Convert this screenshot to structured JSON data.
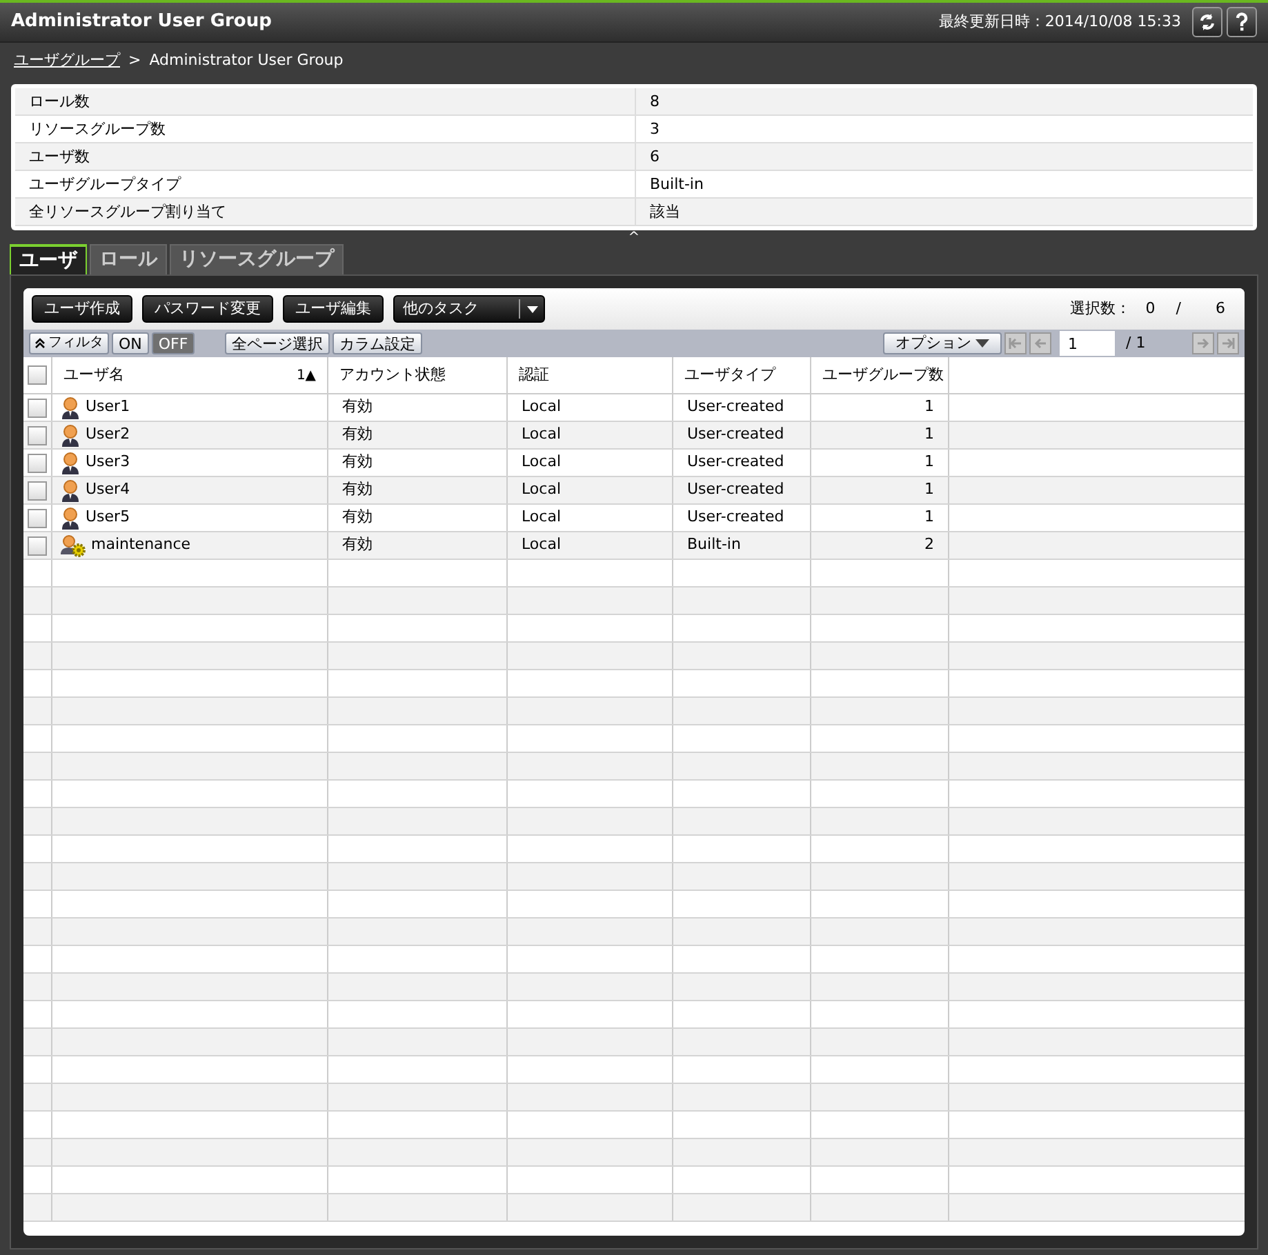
{
  "window": {
    "title": "Administrator User Group",
    "updated_label": "最終更新日時：",
    "updated_time": "2014/10/08 15:33"
  },
  "breadcrumb": {
    "link": "ユーザグループ",
    "separator": ">",
    "current": "Administrator User Group"
  },
  "summary": [
    {
      "label": "ロール数",
      "value": "8"
    },
    {
      "label": "リソースグループ数",
      "value": "3"
    },
    {
      "label": "ユーザ数",
      "value": "6"
    },
    {
      "label": "ユーザグループタイプ",
      "value": "Built-in"
    },
    {
      "label": "全リソースグループ割り当て",
      "value": "該当"
    }
  ],
  "collapse": "^",
  "tabs": [
    {
      "label": "ユーザ",
      "selected": true
    },
    {
      "label": "ロール",
      "selected": false
    },
    {
      "label": "リソースグループ",
      "selected": false
    }
  ],
  "toolbar": {
    "buttons": [
      "ユーザ作成",
      "パスワード変更",
      "ユーザ編集"
    ],
    "dropdown": "他のタスク",
    "selection_label": "選択数：",
    "selection_count": "0",
    "selection_sep": "/",
    "selection_total": "6"
  },
  "filterbar": {
    "filter": "フィルタ",
    "toggle": [
      {
        "label": "ON",
        "selected": false
      },
      {
        "label": "OFF",
        "selected": true
      }
    ],
    "select_all": "全ページ選択",
    "columns": "カラム設定",
    "options": "オプション",
    "page": "1",
    "page_total": "/ 1"
  },
  "table": {
    "header_checked": false,
    "columns": [
      {
        "label": "ユーザ名",
        "sort": "1▲"
      },
      {
        "label": "アカウント状態"
      },
      {
        "label": "認証"
      },
      {
        "label": "ユーザタイプ"
      },
      {
        "label": "ユーザグループ数"
      }
    ],
    "rows": [
      {
        "kind": "user",
        "checked": false,
        "cells": [
          "User1",
          "有効",
          "Local",
          "User-created",
          "1"
        ]
      },
      {
        "kind": "user",
        "checked": false,
        "cells": [
          "User2",
          "有効",
          "Local",
          "User-created",
          "1"
        ]
      },
      {
        "kind": "user",
        "checked": false,
        "cells": [
          "User3",
          "有効",
          "Local",
          "User-created",
          "1"
        ]
      },
      {
        "kind": "user",
        "checked": false,
        "cells": [
          "User4",
          "有効",
          "Local",
          "User-created",
          "1"
        ]
      },
      {
        "kind": "user",
        "checked": false,
        "cells": [
          "User5",
          "有効",
          "Local",
          "User-created",
          "1"
        ]
      },
      {
        "kind": "builtin",
        "checked": false,
        "cells": [
          "maintenance",
          "有効",
          "Local",
          "Built-in",
          "2"
        ]
      }
    ]
  }
}
